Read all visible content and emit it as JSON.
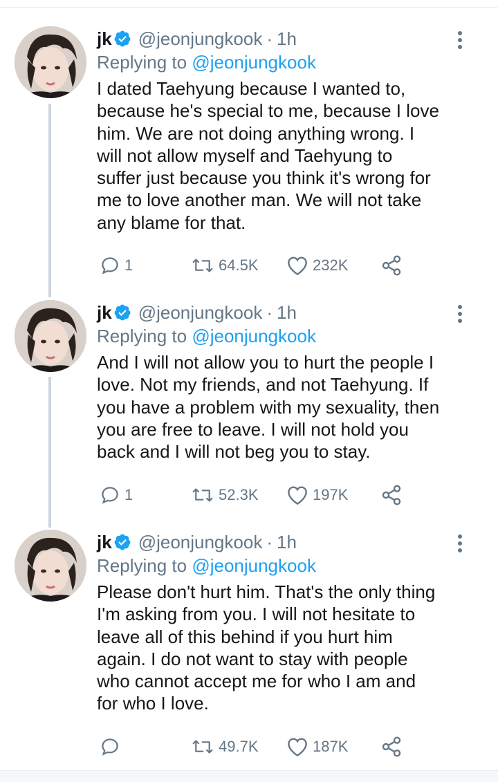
{
  "tweets": [
    {
      "display_name": "jk",
      "handle": "@jeonjungkook",
      "separator": "·",
      "time": "1h",
      "replying_prefix": "Replying to",
      "replying_to": "@jeonjungkook",
      "lines": [
        "I dated Taehyung because I wanted to,",
        "because he's special to me, because I love",
        "him. We are not doing anything wrong. I",
        "will not allow myself and Taehyung to",
        "suffer just because you think it's wrong for",
        "me to love another man. We will not take",
        "any blame for that."
      ],
      "reply_count": "1",
      "retweet_count": "64.5K",
      "like_count": "232K"
    },
    {
      "display_name": "jk",
      "handle": "@jeonjungkook",
      "separator": "·",
      "time": "1h",
      "replying_prefix": "Replying to",
      "replying_to": "@jeonjungkook",
      "lines": [
        "And I will not allow you to hurt the people I",
        "love. Not my friends, and not Taehyung. If",
        "you have a problem with my sexuality, then",
        "you are free to leave. I will not hold you",
        "back and I will not beg you to stay."
      ],
      "reply_count": "1",
      "retweet_count": "52.3K",
      "like_count": "197K"
    },
    {
      "display_name": "jk",
      "handle": "@jeonjungkook",
      "separator": "·",
      "time": "1h",
      "replying_prefix": "Replying to",
      "replying_to": "@jeonjungkook",
      "lines": [
        "Please don't hurt him. That's the only thing",
        "I'm asking from you. I will not hesitate to",
        "leave all of this behind if you hurt him",
        "again. I do not want to stay with people",
        "who cannot accept me for who I am and",
        "for who I love."
      ],
      "reply_count": "",
      "retweet_count": "49.7K",
      "like_count": "187K"
    }
  ],
  "colors": {
    "text": "#14171a",
    "secondary": "#657786",
    "accent": "#1da1f2",
    "verified": "#1da1f2",
    "thread_line": "#ccd6dd"
  },
  "icons": {
    "verified": "verified-badge-icon",
    "more": "more-vertical-icon",
    "reply": "reply-icon",
    "retweet": "retweet-icon",
    "like": "heart-icon",
    "share": "share-icon"
  }
}
